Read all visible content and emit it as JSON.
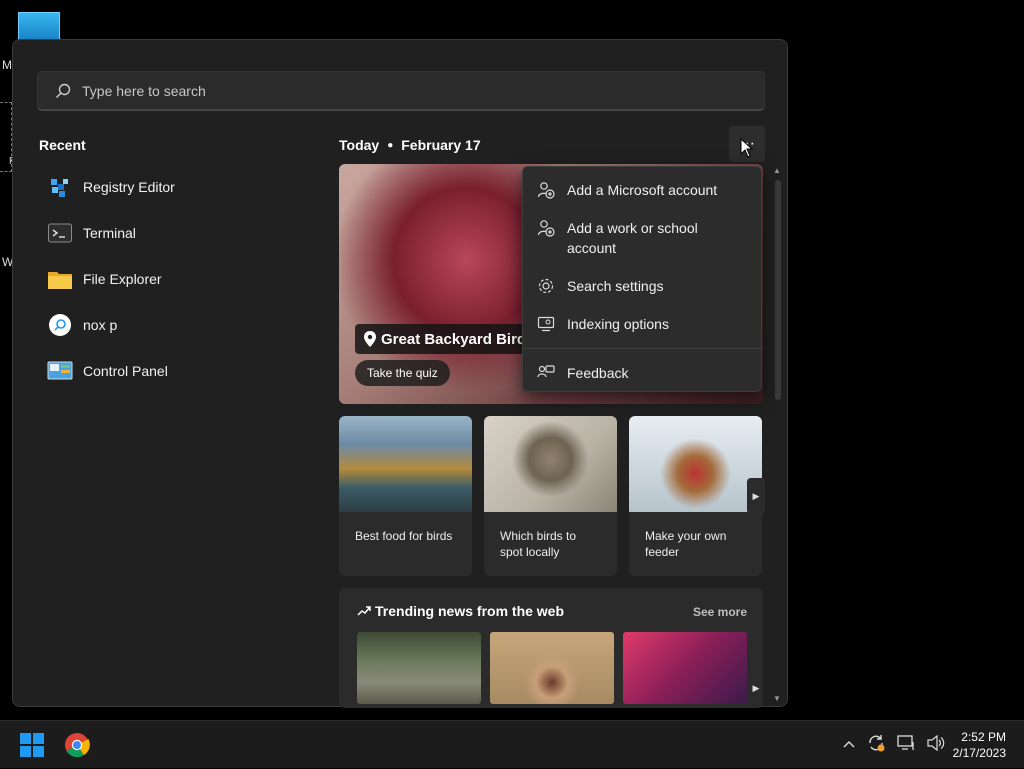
{
  "desktop": {
    "letters": [
      "M",
      "F",
      "W"
    ]
  },
  "search": {
    "placeholder": "Type here to search"
  },
  "recent": {
    "title": "Recent",
    "items": [
      {
        "label": "Registry Editor",
        "icon": "registry-editor-icon"
      },
      {
        "label": "Terminal",
        "icon": "terminal-icon"
      },
      {
        "label": "File Explorer",
        "icon": "folder-icon"
      },
      {
        "label": "nox p",
        "icon": "search-history-icon"
      },
      {
        "label": "Control Panel",
        "icon": "control-panel-icon"
      }
    ]
  },
  "today": {
    "label": "Today",
    "date": "February 17"
  },
  "hero": {
    "title": "Great Backyard Bird C",
    "button": "Take the quiz"
  },
  "cards": [
    {
      "caption": "Best food for birds"
    },
    {
      "caption": "Which birds to spot locally"
    },
    {
      "caption": "Make your own feeder"
    }
  ],
  "trending": {
    "title": "Trending news from the web",
    "see_more": "See more"
  },
  "menu": {
    "items": [
      {
        "label": "Add a Microsoft account",
        "icon": "add-account-icon"
      },
      {
        "label": "Add a work or school account",
        "icon": "add-account-icon"
      },
      {
        "label": "Search settings",
        "icon": "gear-icon"
      },
      {
        "label": "Indexing options",
        "icon": "indexing-icon"
      },
      {
        "label": "Feedback",
        "icon": "feedback-icon"
      }
    ]
  },
  "taskbar": {
    "time": "2:52 PM",
    "date": "2/17/2023"
  },
  "colors": {
    "panel": "#202020",
    "menu": "#2c2c2c",
    "taskbar": "#1c1c1c",
    "windows_blue": "#1e9bf0"
  }
}
